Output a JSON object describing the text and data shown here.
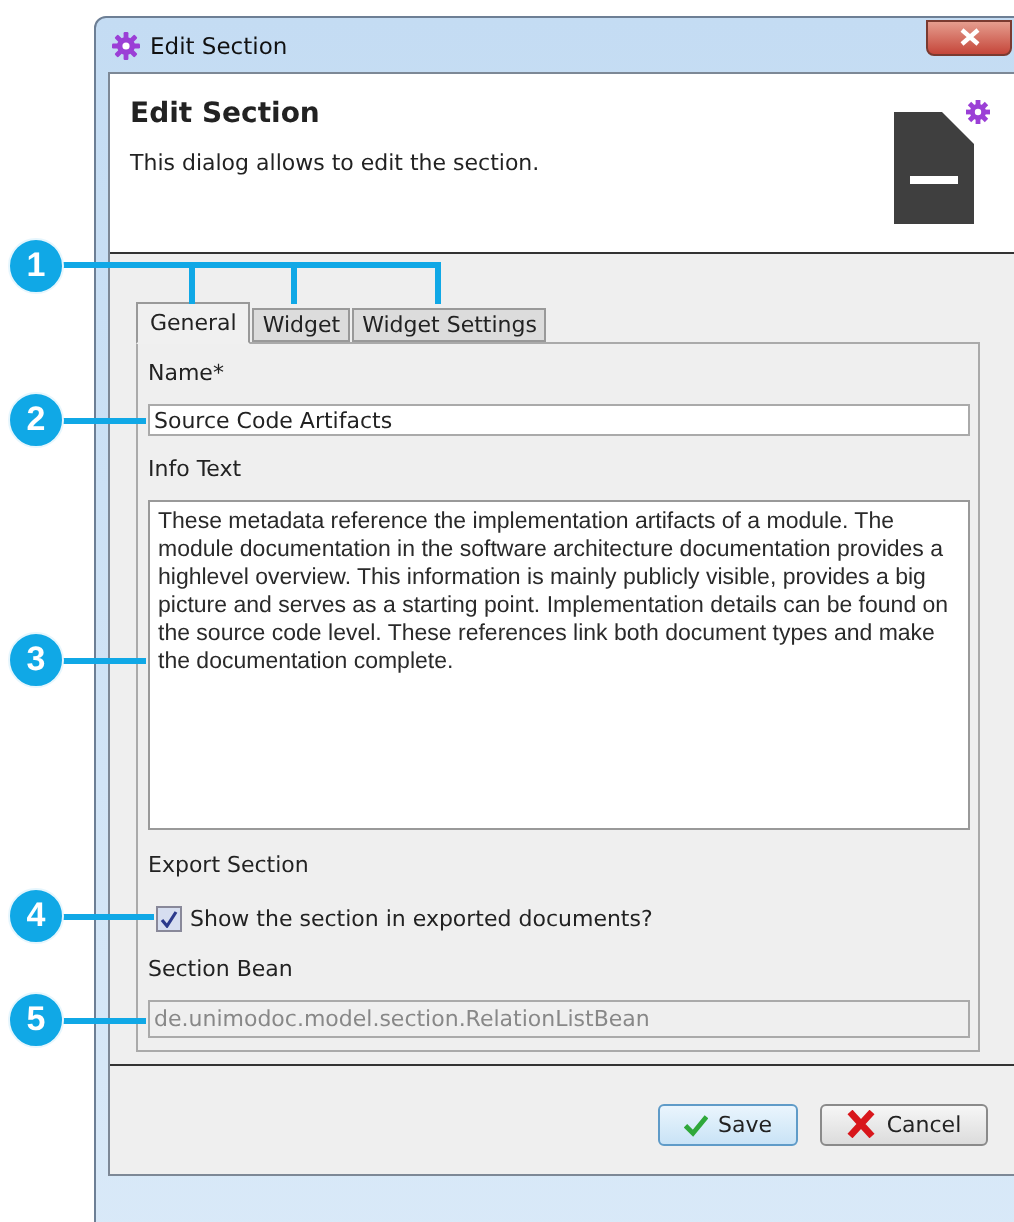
{
  "window": {
    "title": "Edit Section"
  },
  "header": {
    "title": "Edit Section",
    "description": "This dialog allows to edit the section."
  },
  "tabs": [
    {
      "label": "General",
      "selected": true
    },
    {
      "label": "Widget",
      "selected": false
    },
    {
      "label": "Widget Settings",
      "selected": false
    }
  ],
  "form": {
    "name_label": "Name*",
    "name_value": "Source Code Artifacts",
    "info_label": "Info Text",
    "info_value": "These metadata reference the implementation artifacts of a module. The module documentation in the software architecture documentation provides a highlevel overview. This information is mainly publicly visible, provides a big picture and serves as a starting point. Implementation details can be found on the source code level. These references link both document types and make the documentation complete.",
    "export_label": "Export Section",
    "export_checkbox": {
      "label": "Show the section in exported documents?",
      "checked": true
    },
    "bean_label": "Section Bean",
    "bean_value": "de.unimodoc.model.section.RelationListBean",
    "bean_disabled": true
  },
  "buttons": [
    {
      "label": "Save",
      "kind": "save"
    },
    {
      "label": "Cancel",
      "kind": "cancel"
    }
  ],
  "callouts": [
    {
      "number": "1"
    },
    {
      "number": "2"
    },
    {
      "number": "3"
    },
    {
      "number": "4"
    },
    {
      "number": "5"
    }
  ]
}
